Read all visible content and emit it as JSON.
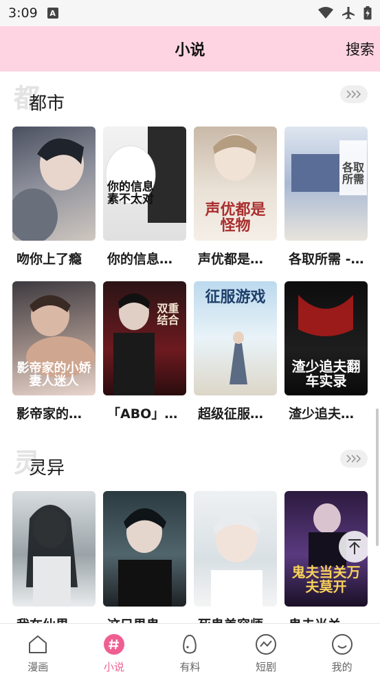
{
  "status_bar": {
    "time": "3:09",
    "notification_icon": "a-notification-icon",
    "icons": [
      "wifi-icon",
      "airplane-icon",
      "battery-icon"
    ]
  },
  "header": {
    "title": "小说",
    "search_label": "搜索",
    "bg_color": "#ffd4e2"
  },
  "sections": [
    {
      "watermark": "都",
      "title": "都市",
      "more_icon": "chevron-triple-icon",
      "books": [
        {
          "title": "吻你上了瘾",
          "cover_text": ""
        },
        {
          "title": "你的信息…",
          "cover_text": "你的信息素不太对"
        },
        {
          "title": "声优都是…",
          "cover_text": "声优都是怪物"
        },
        {
          "title": "各取所需 -…",
          "cover_text": "各取所需"
        },
        {
          "title": "影帝家的…",
          "cover_text": "影帝家的小娇妻人迷人"
        },
        {
          "title": "「ABO」…",
          "cover_text": "双重结合"
        },
        {
          "title": "超级征服…",
          "cover_text": "征服游戏"
        },
        {
          "title": "渣少追夫…",
          "cover_text": "渣少追夫翻车实录"
        }
      ]
    },
    {
      "watermark": "灵",
      "title": "灵异",
      "more_icon": "chevron-triple-icon",
      "books": [
        {
          "title": "我在仙界…",
          "cover_text": ""
        },
        {
          "title": "这只男鬼…",
          "cover_text": ""
        },
        {
          "title": "死鬼美容师",
          "cover_text": ""
        },
        {
          "title": "鬼夫当关…",
          "cover_text": "鬼夫当关万夫莫开"
        }
      ]
    }
  ],
  "tabs": [
    {
      "label": "漫画",
      "icon": "home-icon",
      "active": false
    },
    {
      "label": "小说",
      "icon": "hash-icon",
      "active": true
    },
    {
      "label": "有料",
      "icon": "egg-icon",
      "active": false
    },
    {
      "label": "短剧",
      "icon": "trend-icon",
      "active": false
    },
    {
      "label": "我的",
      "icon": "smile-icon",
      "active": false
    }
  ],
  "accent_color": "#ef5f92"
}
